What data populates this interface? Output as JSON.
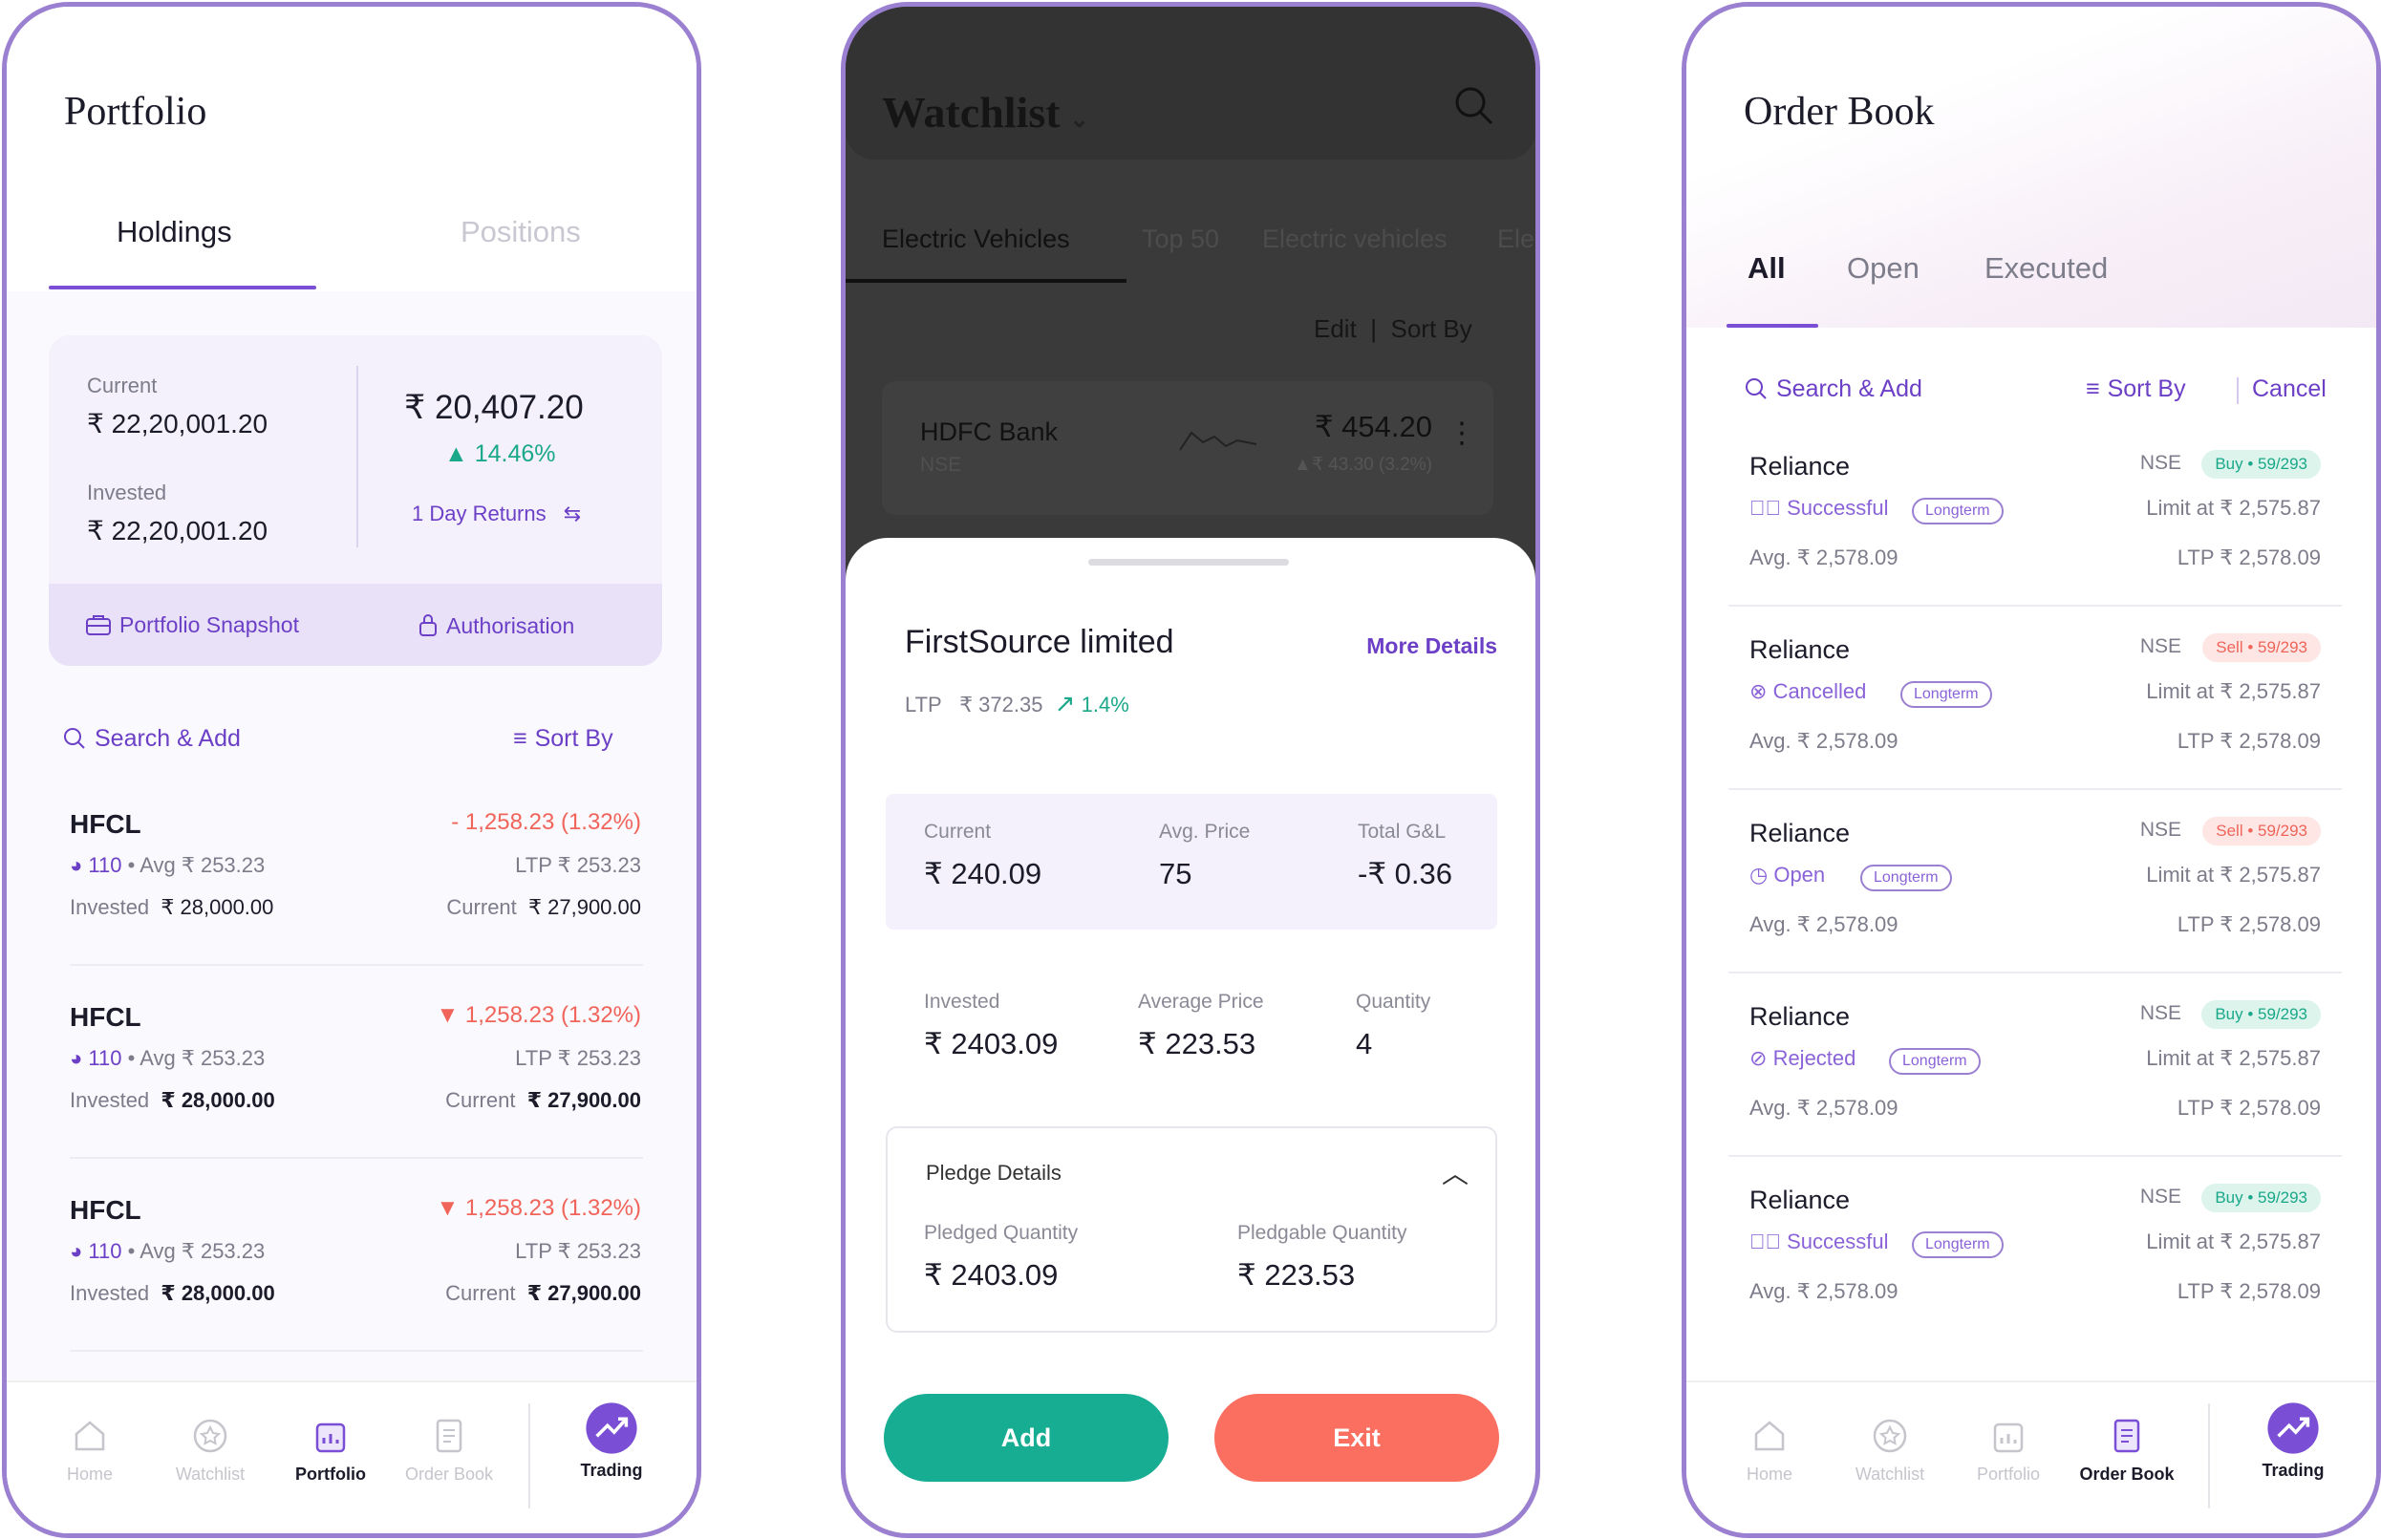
{
  "portfolio": {
    "title": "Portfolio",
    "tabs": [
      "Holdings",
      "Positions"
    ],
    "summary": {
      "current_label": "Current",
      "current_value": "₹ 22,20,001.20",
      "invested_label": "Invested",
      "invested_value": "₹ 22,20,001.20",
      "total": "₹ 20,407.20",
      "pct": "14.46%",
      "returns_toggle": "1 Day Returns",
      "snapshot": "Portfolio Snapshot",
      "authorisation": "Authorisation"
    },
    "search": "Search & Add",
    "sort": "Sort By",
    "holdings": [
      {
        "name": "HFCL",
        "change": "- 1,258.23 (1.32%)",
        "qty": "110",
        "avg": "Avg ₹ 253.23",
        "ltp": "LTP ₹ 253.23",
        "invested_label": "Invested",
        "invested": "₹ 28,000.00",
        "current_label": "Current",
        "current": "₹ 27,900.00"
      },
      {
        "name": "HFCL",
        "change": "1,258.23 (1.32%)",
        "qty": "110",
        "avg": "Avg ₹ 253.23",
        "ltp": "LTP ₹ 253.23",
        "invested_label": "Invested",
        "invested": "₹ 28,000.00",
        "current_label": "Current",
        "current": "₹ 27,900.00"
      },
      {
        "name": "HFCL",
        "change": "1,258.23 (1.32%)",
        "qty": "110",
        "avg": "Avg ₹ 253.23",
        "ltp": "LTP ₹ 253.23",
        "invested_label": "Invested",
        "invested": "₹ 28,000.00",
        "current_label": "Current",
        "current": "₹ 27,900.00"
      }
    ],
    "nav": [
      "Home",
      "Watchlist",
      "Portfolio",
      "Order Book",
      "Trading"
    ]
  },
  "watchlist": {
    "title": "Watchlist",
    "tabs": [
      "Electric Vehicles",
      "Top 50",
      "Electric vehicles",
      "Ele"
    ],
    "edit": "Edit",
    "sep": "|",
    "sort": "Sort By",
    "stock": {
      "name": "HDFC Bank",
      "exchange": "NSE",
      "price": "₹ 454.20",
      "change": "43.30 (3.2%)"
    },
    "sheet": {
      "name": "FirstSource limited",
      "more": "More Details",
      "ltp_label": "LTP",
      "ltp": "₹ 372.35",
      "ltp_change": "1.4%",
      "metrics1": [
        {
          "label": "Current",
          "value": "₹ 240.09"
        },
        {
          "label": "Avg. Price",
          "value": "75"
        },
        {
          "label": "Total G&L",
          "value": "-₹ 0.36"
        }
      ],
      "metrics2": [
        {
          "label": "Invested",
          "value": "₹ 2403.09"
        },
        {
          "label": "Average Price",
          "value": "₹ 223.53"
        },
        {
          "label": "Quantity",
          "value": "4"
        }
      ],
      "pledge": {
        "title": "Pledge Details",
        "pledged_label": "Pledged Quantity",
        "pledged": "₹ 2403.09",
        "pledgable_label": "Pledgable Quantity",
        "pledgable": "₹ 223.53"
      },
      "add": "Add",
      "exit": "Exit"
    }
  },
  "orderbook": {
    "title": "Order Book",
    "tabs": [
      "All",
      "Open",
      "Executed"
    ],
    "search": "Search & Add",
    "sort": "Sort By",
    "cancel": "Cancel",
    "orders": [
      {
        "name": "Reliance",
        "exchange": "NSE",
        "side": "Buy • 59/293",
        "type": "buy",
        "status": "Successful",
        "tag": "Longterm",
        "limit": "Limit at ₹ 2,575.87",
        "avg": "Avg. ₹ 2,578.09",
        "ltp": "LTP ₹ 2,578.09"
      },
      {
        "name": "Reliance",
        "exchange": "NSE",
        "side": "Sell • 59/293",
        "type": "sell",
        "status": "Cancelled",
        "tag": "Longterm",
        "limit": "Limit at ₹ 2,575.87",
        "avg": "Avg. ₹ 2,578.09",
        "ltp": "LTP ₹ 2,578.09"
      },
      {
        "name": "Reliance",
        "exchange": "NSE",
        "side": "Sell • 59/293",
        "type": "sell",
        "status": "Open",
        "tag": "Longterm",
        "limit": "Limit at ₹ 2,575.87",
        "avg": "Avg. ₹ 2,578.09",
        "ltp": "LTP ₹ 2,578.09"
      },
      {
        "name": "Reliance",
        "exchange": "NSE",
        "side": "Buy • 59/293",
        "type": "buy",
        "status": "Rejected",
        "tag": "Longterm",
        "limit": "Limit at ₹ 2,575.87",
        "avg": "Avg. ₹ 2,578.09",
        "ltp": "LTP ₹ 2,578.09"
      },
      {
        "name": "Reliance",
        "exchange": "NSE",
        "side": "Buy • 59/293",
        "type": "buy",
        "status": "Successful",
        "tag": "Longterm",
        "limit": "Limit at ₹ 2,575.87",
        "avg": "Avg. ₹ 2,578.09",
        "ltp": "LTP ₹ 2,578.09"
      }
    ],
    "nav": [
      "Home",
      "Watchlist",
      "Portfolio",
      "Order Book",
      "Trading"
    ]
  }
}
